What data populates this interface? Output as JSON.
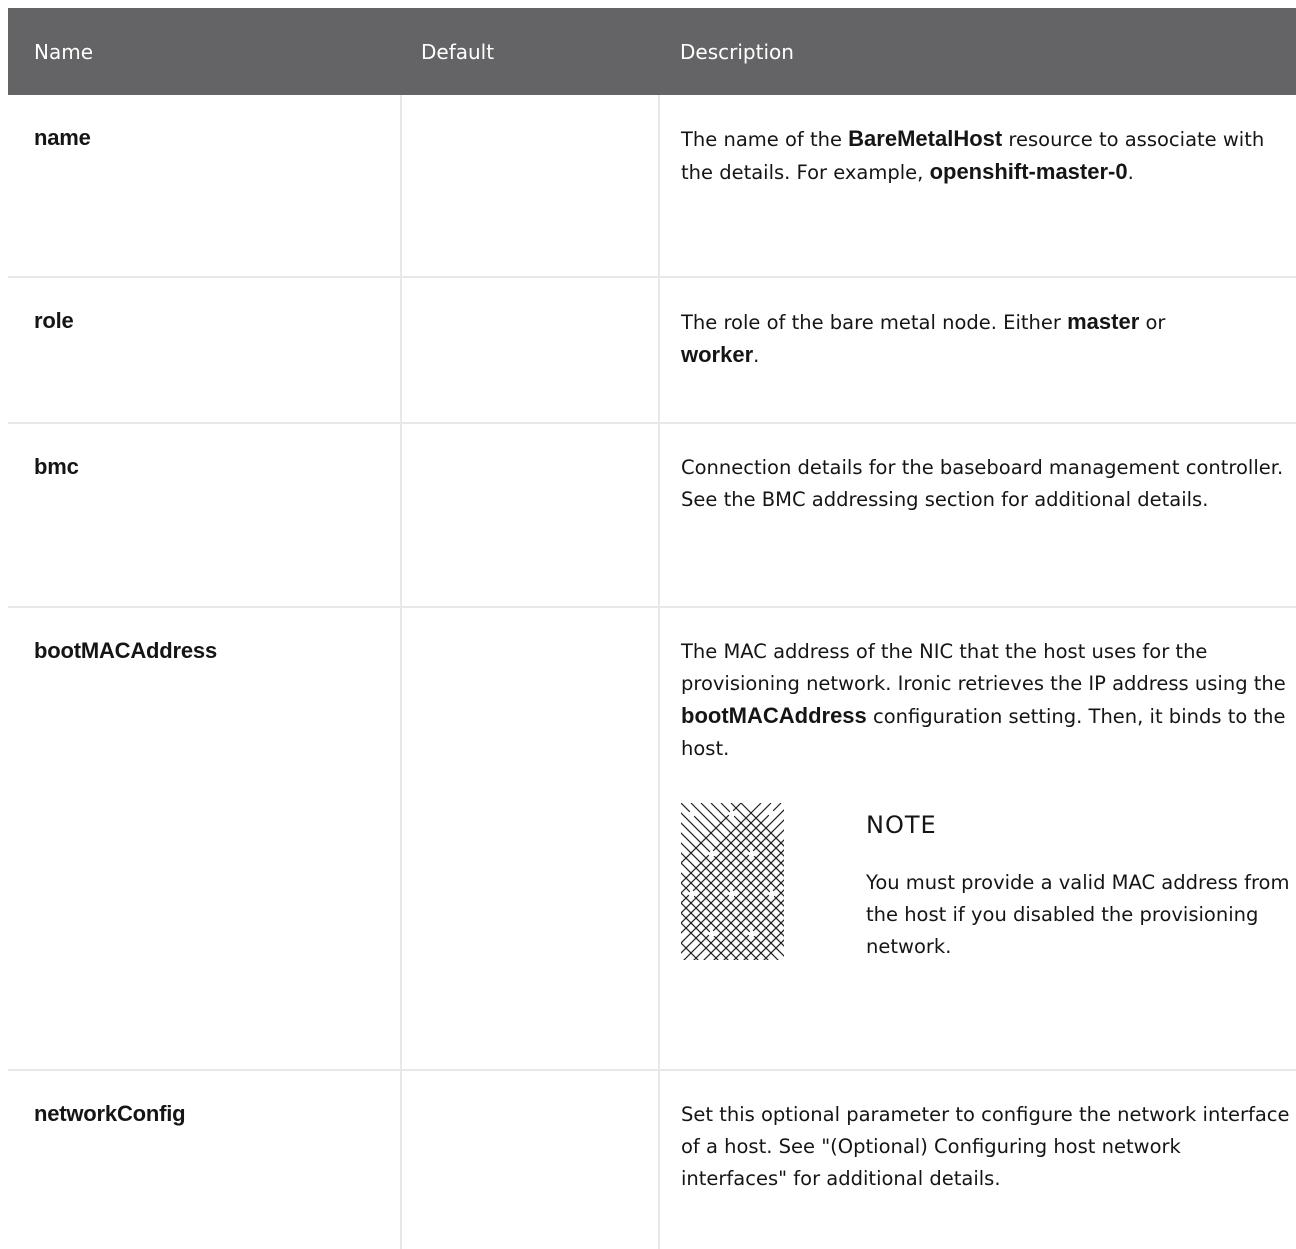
{
  "table": {
    "headers": {
      "name": "Name",
      "default": "Default",
      "description": "Description"
    },
    "rows": [
      {
        "name": "name",
        "default": "",
        "desc": {
          "p1": "The name of the ",
          "b1": "BareMetalHost",
          "p2": " resource to associate with the details. For example, ",
          "b2": "openshift-master-0",
          "p3": "."
        }
      },
      {
        "name": "role",
        "default": "",
        "desc": {
          "p1": "The role of the bare metal node. Either ",
          "b1": "master",
          "p2": " or ",
          "b2": "worker",
          "p3": "."
        }
      },
      {
        "name": "bmc",
        "default": "",
        "desc": {
          "p1": "Connection details for the baseboard management controller. See the BMC addressing section for additional details."
        }
      },
      {
        "name": "bootMACAddress",
        "default": "",
        "desc": {
          "p1": "The MAC address of the NIC that the host uses for the provisioning network. Ironic retrieves the IP address using the ",
          "b1": "bootMACAddress",
          "p2": " configuration setting. Then, it binds to the host."
        },
        "note": {
          "title": "NOTE",
          "body": "You must provide a valid MAC address from the host if you disabled the provisioning network.",
          "icon": "note-pattern-icon"
        }
      },
      {
        "name": "networkConfig",
        "default": "",
        "desc": {
          "p1": "Set this optional parameter to configure the network interface of a host. See \"(Optional) Configuring host network interfaces\" for additional details."
        }
      }
    ]
  },
  "colors": {
    "header_bg": "#646466",
    "header_text": "#ffffff",
    "border": "#e8e8e8",
    "text": "#151515"
  }
}
